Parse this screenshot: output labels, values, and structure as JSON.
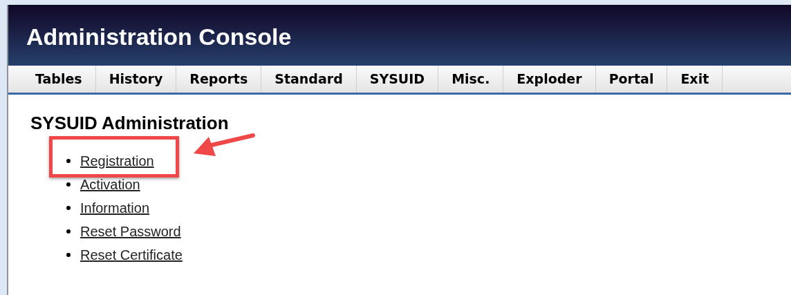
{
  "header": {
    "title": "Administration Console"
  },
  "nav": [
    {
      "label": "Tables"
    },
    {
      "label": "History"
    },
    {
      "label": "Reports"
    },
    {
      "label": "Standard"
    },
    {
      "label": "SYSUID"
    },
    {
      "label": "Misc."
    },
    {
      "label": "Exploder"
    },
    {
      "label": "Portal"
    },
    {
      "label": "Exit"
    }
  ],
  "page": {
    "heading": "SYSUID Administration",
    "links": [
      {
        "label": "Registration",
        "highlighted": true
      },
      {
        "label": "Activation",
        "highlighted": false
      },
      {
        "label": "Information",
        "highlighted": false
      },
      {
        "label": "Reset Password",
        "highlighted": false
      },
      {
        "label": "Reset Certificate",
        "highlighted": false
      }
    ]
  }
}
